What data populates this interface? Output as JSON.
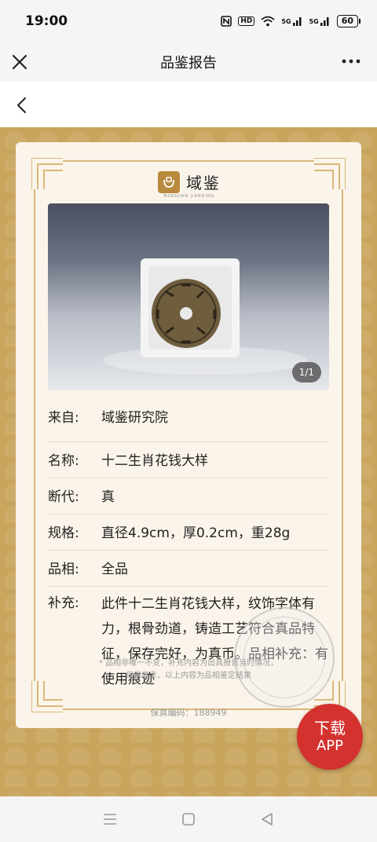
{
  "status": {
    "time": "19:00",
    "battery": "60",
    "signal1": "5G",
    "signal2": "5G",
    "hd": "HD"
  },
  "titlebar": {
    "title": "品鉴报告"
  },
  "logo": {
    "name": "域鉴",
    "sub": "MINGJIAN JIANDING"
  },
  "photo": {
    "counter": "1/1"
  },
  "info": [
    {
      "key": "来自:",
      "value": "域鉴研究院"
    },
    {
      "key": "名称:",
      "value": "十二生肖花钱大样"
    },
    {
      "key": "断代:",
      "value": "真"
    },
    {
      "key": "规格:",
      "value": "直径4.9cm，厚0.2cm，重28g"
    },
    {
      "key": "品相:",
      "value": "全品"
    },
    {
      "key": "补充:",
      "value": "此件十二生肖花钱大样，纹饰字体有力，根骨劲道，铸造工艺符合真品特征，保存完好，为真币。品相补充：有使用痕迹"
    }
  ],
  "note": {
    "line1": "* 品相非唯一不变，补充内容为出具报告当时情况，",
    "line2": "仅供参考。以上内容为品相鉴定结果"
  },
  "serial": "保真编码：188949",
  "download": {
    "line1": "下载",
    "line2": "APP"
  }
}
